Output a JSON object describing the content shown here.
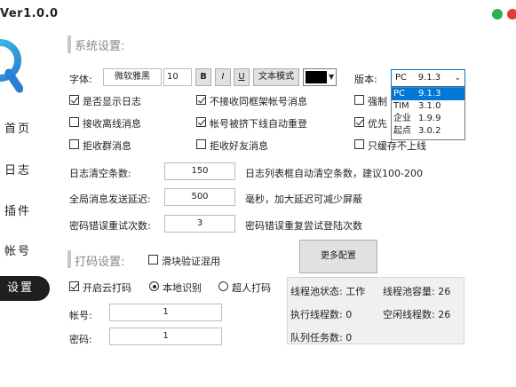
{
  "app": {
    "title": "Ver1.0.0",
    "status_dots": {
      "green": "#2bb24c",
      "red": "#e53935"
    }
  },
  "sidebar": {
    "items": [
      {
        "label": "首页"
      },
      {
        "label": "日志"
      },
      {
        "label": "插件"
      },
      {
        "label": "帐号"
      },
      {
        "label": "设置"
      }
    ],
    "active_index": 4,
    "accent": "#1f1f1f"
  },
  "system": {
    "heading": "系统设置:",
    "font_label": "字体:",
    "font_name": "微软雅黑",
    "font_size": "10",
    "bold": "B",
    "italic": "I",
    "underline": "U",
    "text_mode": "文本模式",
    "color_value": "#000000",
    "version_label": "版本:",
    "version_selected": "PC    9.1.3",
    "version_options": [
      {
        "name": "PC",
        "ver": "9.1.3"
      },
      {
        "name": "TIM",
        "ver": "3.1.0"
      },
      {
        "name": "企业",
        "ver": "1.9.9"
      },
      {
        "name": "起点",
        "ver": "3.0.2"
      }
    ],
    "checkboxes": {
      "show_log": {
        "label": "是否显示日志",
        "checked": true
      },
      "no_frame_accounts": {
        "label": "不接收同框架帐号消息",
        "checked": true
      },
      "force": {
        "label": "强制",
        "checked": false
      },
      "offline_msg": {
        "label": "接收离线消息",
        "checked": false
      },
      "auto_relogin": {
        "label": "帐号被挤下线自动重登",
        "checked": true
      },
      "priority": {
        "label": "优先",
        "checked": true
      },
      "reject_group": {
        "label": "拒收群消息",
        "checked": false
      },
      "reject_friend": {
        "label": "拒收好友消息",
        "checked": false
      },
      "cache_only_online": {
        "label": "只缓存不上线",
        "checked": false
      }
    },
    "log_clear_label": "日志清空条数:",
    "log_clear_value": "150",
    "log_clear_hint": "日志列表框自动清空条数，建议100-200",
    "send_delay_label": "全局消息发送延迟:",
    "send_delay_value": "500",
    "send_delay_hint": "毫秒，加大延迟可减少屏蔽",
    "retry_label": "密码错误重试次数:",
    "retry_value": "3",
    "retry_hint": "密码错误重复尝试登陆次数"
  },
  "captcha": {
    "heading": "打码设置:",
    "slider_mix": {
      "label": "滑块验证混用",
      "checked": false
    },
    "cloud_captcha": {
      "label": "开启云打码",
      "checked": true
    },
    "local_recognition": {
      "label": "本地识别",
      "checked": true
    },
    "super_captcha": {
      "label": "超人打码",
      "checked": false
    },
    "account_label": "帐号:",
    "account_value": "1",
    "password_label": "密码:",
    "password_value": "1",
    "more_button": "更多配置"
  },
  "threadpool": {
    "status": "线程池状态: 工作",
    "capacity": "线程池容量: 26",
    "running": "执行线程数: 0",
    "idle": "空闲线程数: 26",
    "queue": "队列任务数: 0"
  }
}
